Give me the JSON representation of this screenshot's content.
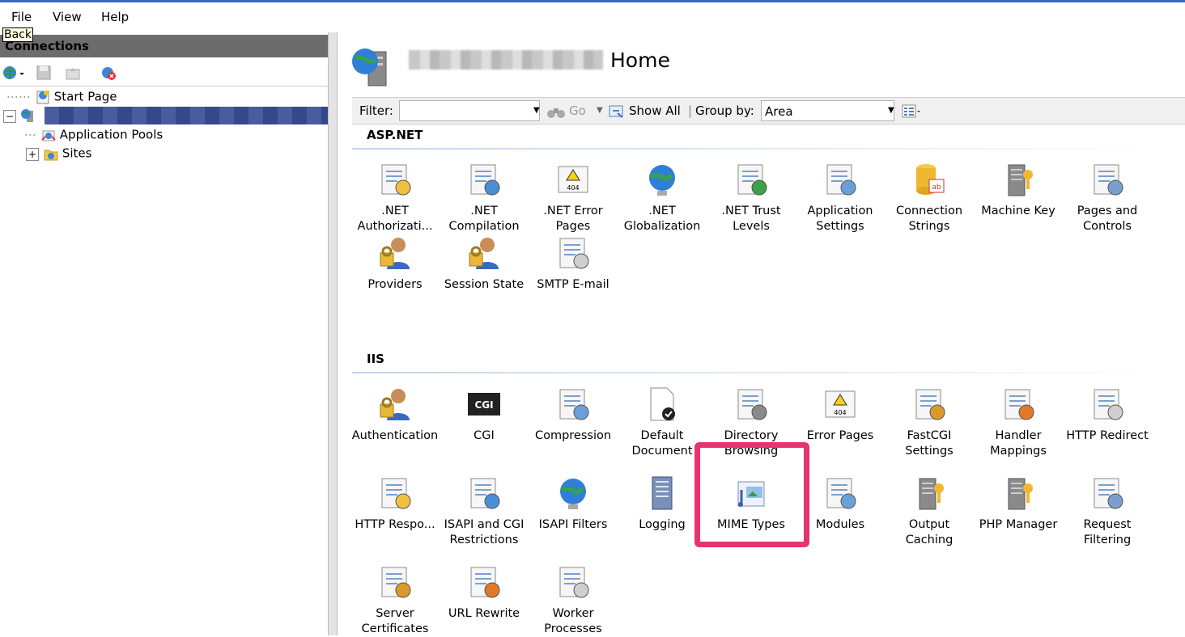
{
  "menu": {
    "file": "File",
    "view": "View",
    "help": "Help"
  },
  "tooltip": "Back",
  "connections": {
    "title": "Connections",
    "tree": {
      "start_page": "Start Page",
      "app_pools": "Application Pools",
      "sites": "Sites"
    }
  },
  "header": {
    "title": "Home"
  },
  "filterbar": {
    "filter_label": "Filter:",
    "go_label": "Go",
    "show_all_label": "Show All",
    "group_by_label": "Group by:",
    "group_by_value": "Area"
  },
  "sections": [
    {
      "title": "ASP.NET",
      "items": [
        {
          "label": ".NET Authorizati...",
          "icon": "lock-document-icon"
        },
        {
          "label": ".NET Compilation",
          "icon": "compile-stack-icon"
        },
        {
          "label": ".NET Error Pages",
          "icon": "error-404-icon"
        },
        {
          "label": ".NET Globalization",
          "icon": "globe-icon"
        },
        {
          "label": ".NET Trust Levels",
          "icon": "trust-check-icon"
        },
        {
          "label": "Application Settings",
          "icon": "settings-list-icon"
        },
        {
          "label": "Connection Strings",
          "icon": "database-icon"
        },
        {
          "label": "Machine Key",
          "icon": "server-key-icon"
        },
        {
          "label": "Pages and Controls",
          "icon": "pages-controls-icon"
        },
        {
          "label": "Providers",
          "icon": "providers-icon"
        },
        {
          "label": "Session State",
          "icon": "session-user-icon"
        },
        {
          "label": "SMTP E-mail",
          "icon": "email-icon"
        }
      ]
    },
    {
      "title": "IIS",
      "items": [
        {
          "label": "Authentication",
          "icon": "user-lock-icon"
        },
        {
          "label": "CGI",
          "icon": "cgi-icon"
        },
        {
          "label": "Compression",
          "icon": "compression-clamp-icon"
        },
        {
          "label": "Default Document",
          "icon": "default-document-icon"
        },
        {
          "label": "Directory Browsing",
          "icon": "directory-browse-icon"
        },
        {
          "label": "Error Pages",
          "icon": "error-404-icon"
        },
        {
          "label": "FastCGI Settings",
          "icon": "fastcgi-icon"
        },
        {
          "label": "Handler Mappings",
          "icon": "handler-arrows-icon"
        },
        {
          "label": "HTTP Redirect",
          "icon": "http-redirect-icon"
        },
        {
          "label": "HTTP Respo...",
          "icon": "http-response-icon"
        },
        {
          "label": "ISAPI and CGI Restrictions",
          "icon": "isapi-cgi-restrict-icon"
        },
        {
          "label": "ISAPI Filters",
          "icon": "isapi-filter-icon"
        },
        {
          "label": "Logging",
          "icon": "logging-book-icon"
        },
        {
          "label": "MIME Types",
          "icon": "mime-media-icon"
        },
        {
          "label": "Modules",
          "icon": "modules-icon"
        },
        {
          "label": "Output Caching",
          "icon": "output-cache-icon"
        },
        {
          "label": "PHP Manager",
          "icon": "php-server-icon"
        },
        {
          "label": "Request Filtering",
          "icon": "request-filter-icon"
        },
        {
          "label": "Server Certificates",
          "icon": "certificates-icon"
        },
        {
          "label": "URL Rewrite",
          "icon": "url-rewrite-icon"
        },
        {
          "label": "Worker Processes",
          "icon": "worker-process-icon"
        }
      ]
    }
  ],
  "colors": {
    "highlight": "#e8336f",
    "selection": "#3a4e98",
    "panel_header": "#6c6c6c"
  }
}
